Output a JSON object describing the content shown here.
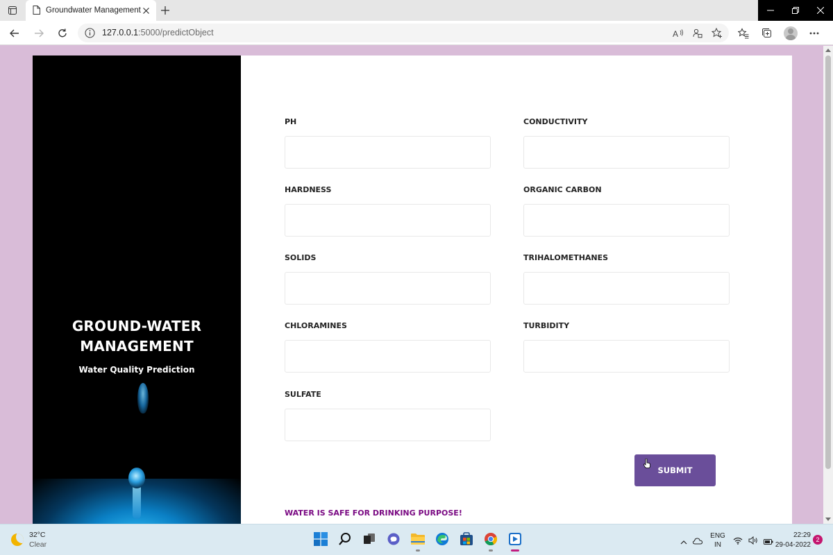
{
  "browser": {
    "tab_title": "Groundwater Management Wate",
    "url_host": "127.0.0.1",
    "url_path": ":5000/predictObject"
  },
  "hero": {
    "title_line1": "GROUND-WATER",
    "title_line2": "MANAGEMENT",
    "subtitle": "Water Quality Prediction"
  },
  "form": {
    "fields": [
      {
        "label": "PH",
        "value": ""
      },
      {
        "label": "CONDUCTIVITY",
        "value": ""
      },
      {
        "label": "HARDNESS",
        "value": ""
      },
      {
        "label": "ORGANIC CARBON",
        "value": ""
      },
      {
        "label": "SOLIDS",
        "value": ""
      },
      {
        "label": "TRIHALOMETHANES",
        "value": ""
      },
      {
        "label": "CHLORAMINES",
        "value": ""
      },
      {
        "label": "TURBIDITY",
        "value": ""
      },
      {
        "label": "SULFATE",
        "value": ""
      }
    ],
    "submit_label": "SUBMIT",
    "result_message": "WATER IS SAFE FOR DRINKING PURPOSE!"
  },
  "colors": {
    "page_background": "#d9bcd8",
    "submit_button": "#6a4e9a",
    "result_text": "#7a0a83",
    "hero_background": "#000000"
  },
  "taskbar": {
    "weather_temp": "32°C",
    "weather_condition": "Clear",
    "lang_line1": "ENG",
    "lang_line2": "IN",
    "time": "22:29",
    "date": "29-04-2022",
    "notification_count": "2",
    "apps": [
      "windows-start-icon",
      "search-icon",
      "task-view-icon",
      "teams-chat-icon",
      "file-explorer-icon",
      "edge-icon",
      "store-icon",
      "chrome-icon",
      "media-player-icon"
    ]
  }
}
